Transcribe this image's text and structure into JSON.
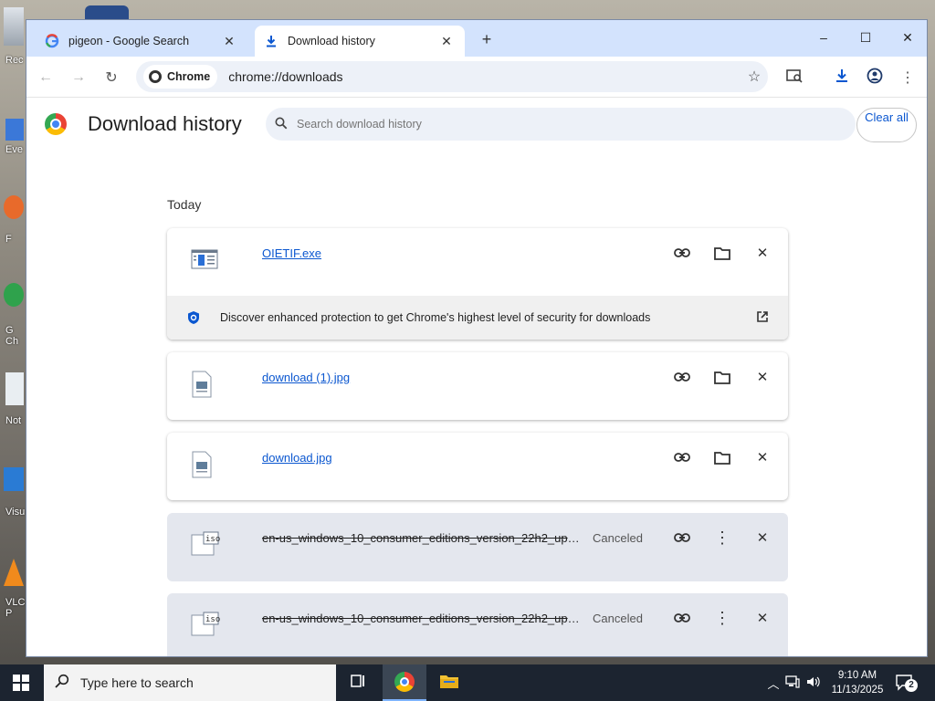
{
  "desktop": {
    "labels": [
      "Rec",
      "Eve",
      "F",
      "G\nCh",
      "Not",
      "Visu",
      "VLC\nP"
    ]
  },
  "window": {
    "tabs": [
      {
        "title": "pigeon - Google Search",
        "icon": "google-g-icon"
      },
      {
        "title": "Download history",
        "icon": "download-icon"
      }
    ],
    "new_tab_label": "+",
    "controls": {
      "minimize": "–",
      "maximize": "☐",
      "close": "✕"
    }
  },
  "toolbar": {
    "chip_label": "Chrome",
    "url": "chrome://downloads"
  },
  "page": {
    "title": "Download history",
    "search_placeholder": "Search download history",
    "clear_all": "Clear all",
    "section_label": "Today",
    "promo_text": "Discover enhanced protection to get Chrome's highest level of security for downloads",
    "items": [
      {
        "name": "OIETIF.exe",
        "status": "",
        "type": "exe"
      },
      {
        "name": "download (1).jpg",
        "status": "",
        "type": "jpg"
      },
      {
        "name": "download.jpg",
        "status": "",
        "type": "jpg"
      },
      {
        "name": "en-us_windows_10_consumer_editions_version_22h2_upd...",
        "status": "Canceled",
        "type": "iso"
      },
      {
        "name": "en-us_windows_10_consumer_editions_version_22h2_upd...",
        "status": "Canceled",
        "type": "iso"
      }
    ]
  },
  "taskbar": {
    "search_placeholder": "Type here to search",
    "time": "9:10 AM",
    "date": "11/13/2025",
    "notification_count": "2"
  }
}
